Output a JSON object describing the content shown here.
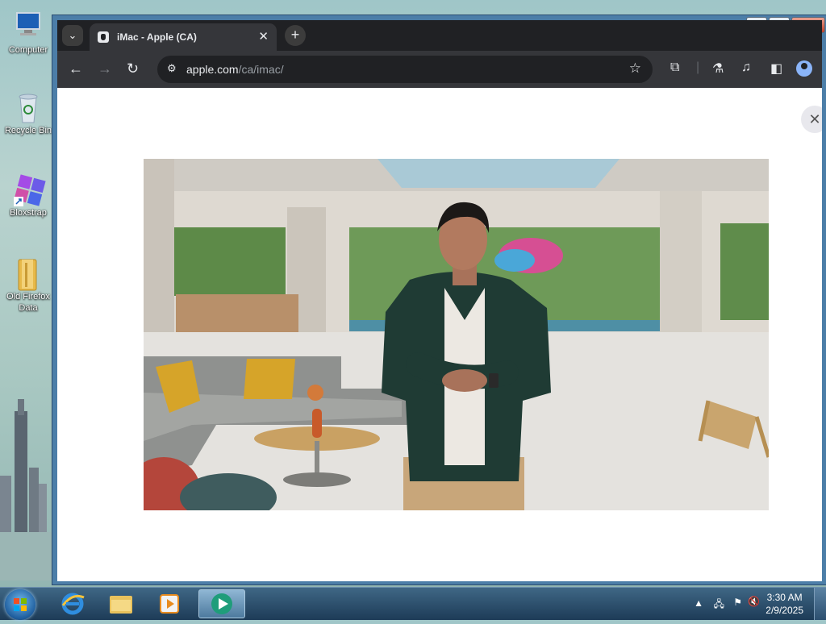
{
  "desktop": {
    "icons": [
      {
        "label": "Computer",
        "icon": "computer-icon"
      },
      {
        "label": "Recycle Bin",
        "icon": "recycle-bin-icon"
      },
      {
        "label": "Bloxstrap",
        "icon": "bloxstrap-icon"
      },
      {
        "label": "Old Firefox Data",
        "icon": "folder-icon"
      }
    ]
  },
  "browser": {
    "tab": {
      "title": "iMac - Apple (CA)",
      "favicon": "apple-icon"
    },
    "new_tab": "+",
    "tab_search": "⌄",
    "url_host": "apple.com",
    "url_path": "/ca/imac/",
    "nav": {
      "back": "←",
      "forward": "→",
      "reload": "↻"
    },
    "star": "☆"
  },
  "page": {
    "modal_close": "✕"
  },
  "taskbar": {
    "apps": [
      "internet-explorer-icon",
      "file-explorer-icon",
      "media-player-icon",
      "browser-app-icon"
    ],
    "time": "3:30 AM",
    "date": "2/9/2025"
  },
  "colors": {
    "chrome_dark": "#202124",
    "toolbar": "#35363a",
    "taskbar": "#1d3b57"
  }
}
